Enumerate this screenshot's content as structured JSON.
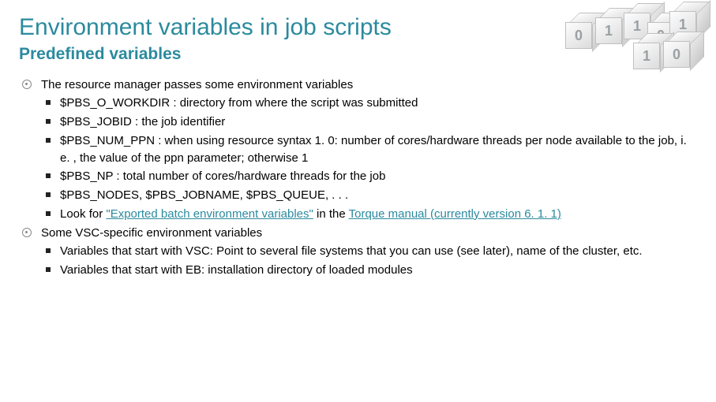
{
  "title": "Environment variables in job scripts",
  "subtitle": "Predefined variables",
  "list1": {
    "heading": "The resource manager passes some environment variables",
    "items": [
      "$PBS_O_WORKDIR : directory from where the script was submitted",
      "$PBS_JOBID : the job identifier",
      "$PBS_NUM_PPN : when using resource syntax 1. 0: number of cores/hardware threads per node available to the job, i. e. , the value of the ppn parameter; otherwise 1",
      "$PBS_NP : total number of cores/hardware threads for the job",
      "$PBS_NODES, $PBS_JOBNAME, $PBS_QUEUE, . . ."
    ],
    "link_item": {
      "prefix": "Look for ",
      "link1": "\"Exported batch environment variables\"",
      "mid": " in the ",
      "link2": "Torque manual (currently version 6. 1. 1)"
    }
  },
  "list2": {
    "heading": "Some VSC-specific environment variables",
    "items": [
      "Variables that start with VSC: Point to several file systems that you can use (see later), name of the cluster, etc.",
      "Variables that start with EB: installation directory of loaded modules"
    ]
  },
  "cubes": [
    "0",
    "1",
    "1",
    "0",
    "1",
    "1",
    "0"
  ]
}
